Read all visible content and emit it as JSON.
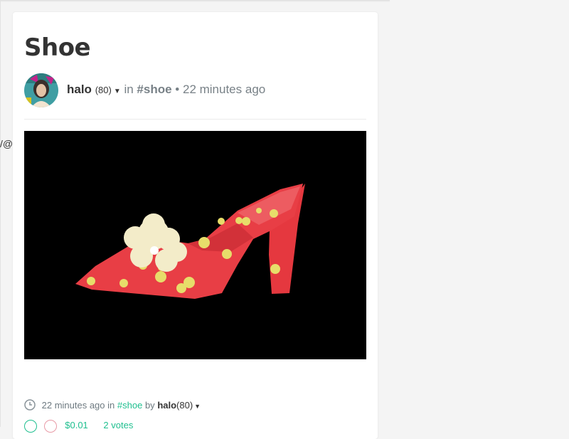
{
  "left_peek": {
    "text": "/@"
  },
  "post": {
    "title": "Shoe",
    "author": "halo",
    "reputation": "(80)",
    "in_label": "in",
    "tag": "#shoe",
    "separator": "•",
    "time_ago": "22 minutes ago"
  },
  "footer": {
    "time_ago": "22 minutes ago",
    "in_label": "in",
    "tag": "#shoe",
    "by_label": "by",
    "author": "halo",
    "reputation": "(80)",
    "payout": "$0.01",
    "votes": "2 votes"
  },
  "icons": {
    "caret": "chevron-down-icon",
    "clock": "clock-icon",
    "upvote": "upvote-icon",
    "downvote": "downvote-icon"
  },
  "colors": {
    "accent": "#1fbf8f",
    "text": "#333333",
    "muted": "#788187",
    "downvote": "#e89aa6"
  }
}
